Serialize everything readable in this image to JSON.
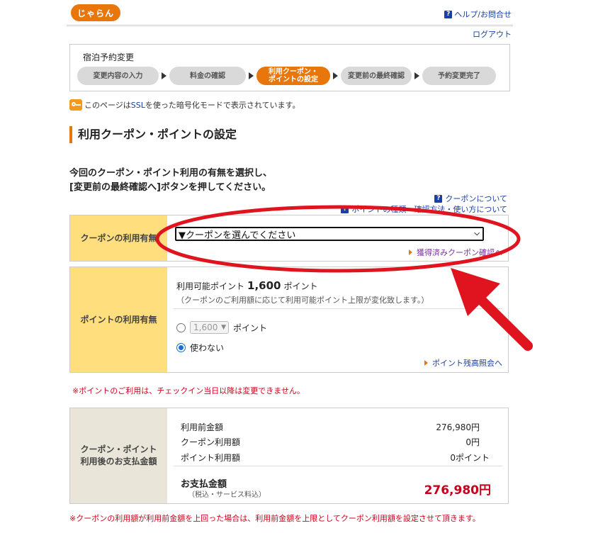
{
  "header": {
    "logo": "じゃらん",
    "help_link": "ヘルプ/お問合せ",
    "logout": "ログアウト"
  },
  "steps_box": {
    "title": "宿泊予約変更",
    "steps": [
      {
        "label": "変更内容の入力"
      },
      {
        "label": "料金の確認"
      },
      {
        "label": "利用クーポン・\nポイントの設定"
      },
      {
        "label": "変更前の最終確認"
      },
      {
        "label": "予約変更完了"
      }
    ],
    "active_index": 2
  },
  "ssl_note": {
    "prefix": "このページは",
    "link": "SSL",
    "suffix": "を使った暗号化モードで表示されています。"
  },
  "page_title": "利用クーポン・ポイントの設定",
  "instruction": {
    "line1": "今回のクーポン・ポイント利用の有無を選択し、",
    "line2": "[変更前の最終確認へ]ボタンを押してください。"
  },
  "help_links": {
    "coupon_about": "クーポンについて",
    "points_about": "ポイントの種類・確認方法・使い方について"
  },
  "coupon": {
    "label": "クーポンの利用有無",
    "select_value": "▼クーポンを選んでください",
    "confirm_link": "獲得済みクーポン確認へ"
  },
  "points": {
    "label": "ポイントの利用有無",
    "available_prefix": "利用可能ポイント",
    "available_value": "1,600",
    "available_unit": "ポイント",
    "note": "（クーポンのご利用額に応じて利用可能ポイント上限が変化致します。）",
    "option_use_select": "1,600",
    "option_use_unit": "ポイント",
    "option_none": "使わない",
    "selected": "none",
    "balance_link": "ポイント残高照会へ"
  },
  "warning_points": "※ポイントのご利用は、チェックイン当日以降は変更できません。",
  "payment": {
    "label_line1": "クーポン・ポイント",
    "label_line2": "利用後のお支払金額",
    "rows": [
      {
        "name": "利用前金額",
        "value": "276,980円"
      },
      {
        "name": "クーポン利用額",
        "value": "0円"
      },
      {
        "name": "ポイント利用額",
        "value": "0ポイント"
      }
    ],
    "total_label": "お支払金額",
    "total_sub": "（税込・サービス料込）",
    "total_value": "276,980円"
  },
  "warning_coupon": "※クーポンの利用額が利用前金額を上回った場合は、利用前金額を上限としてクーポン利用額を設定させて頂きます。",
  "colors": {
    "accent": "#e8760a",
    "label_bg": "#fede7d",
    "annotation_red": "#e0141e",
    "total_red": "#c4001a"
  }
}
